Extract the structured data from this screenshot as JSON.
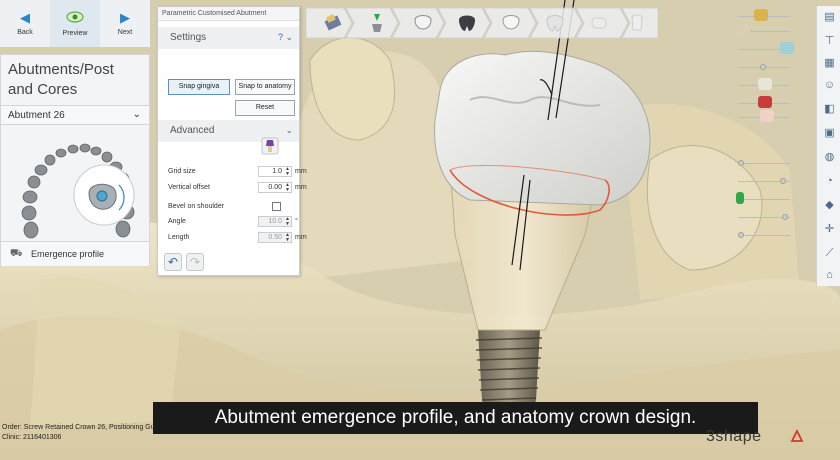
{
  "nav": {
    "back": "Back",
    "preview": "Preview",
    "next": "Next"
  },
  "left_panel": {
    "title_line1": "Abutments/Post",
    "title_line2": "and Cores",
    "selected_abutment": "Abutment 26",
    "footer_label": "Emergence profile"
  },
  "param_panel": {
    "title": "Parametric Customised Abutment",
    "settings_label": "Settings",
    "help": "?",
    "snap_gingiva": "Snap gingiva",
    "snap_anatomy": "Snap to anatomy",
    "reset": "Reset",
    "advanced_label": "Advanced",
    "grid_size_label": "Grid size",
    "grid_size_value": "1.0",
    "vertical_offset_label": "Vertical offset",
    "vertical_offset_value": "0.00",
    "bevel_label": "Bevel on shoulder",
    "angle_label": "Angle",
    "angle_value": "10.0",
    "angle_unit": "°",
    "length_label": "Length",
    "length_value": "0.50",
    "unit_mm": "mm"
  },
  "subtitle": "Abutment emergence profile, and anatomy crown design.",
  "order": {
    "line1": "Order:  Screw Retained Crown 26, Positioning Gui",
    "line2": "Clinic:  2116401306"
  },
  "brand": "3shape",
  "colors": {
    "accent": "#2b86c9",
    "margin_line": "#e05a3a",
    "gingiva": "#e8dcb4"
  }
}
